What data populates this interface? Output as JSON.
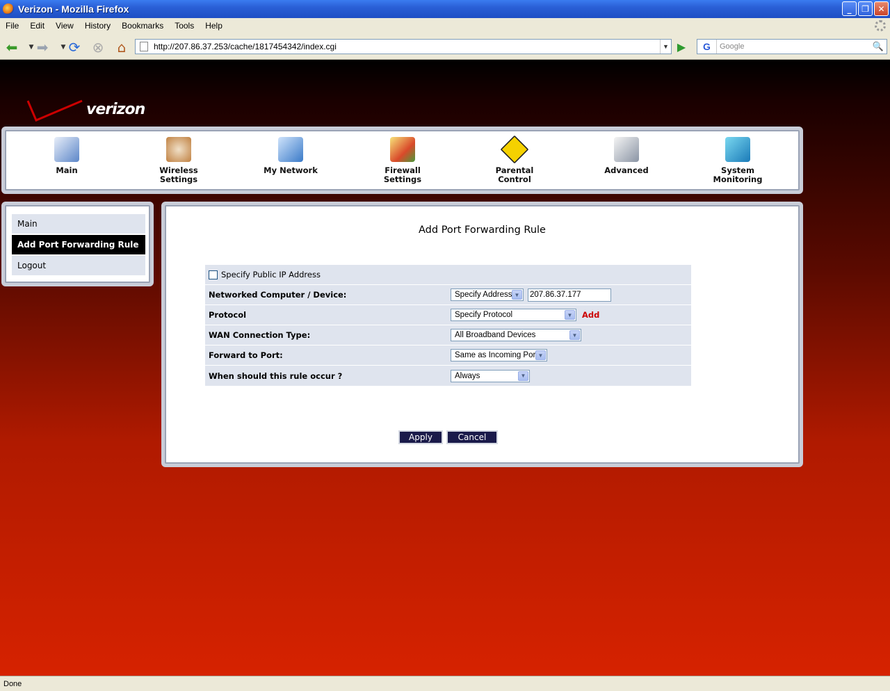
{
  "window": {
    "title": "Verizon - Mozilla Firefox"
  },
  "menu": [
    "File",
    "Edit",
    "View",
    "History",
    "Bookmarks",
    "Tools",
    "Help"
  ],
  "address": {
    "url": "http://207.86.37.253/cache/1817454342/index.cgi"
  },
  "search": {
    "engine": "G",
    "placeholder": "Google"
  },
  "brand": {
    "logo_text": "verizon"
  },
  "topnav": [
    {
      "label": "Main",
      "icon": "main-icon"
    },
    {
      "label": "Wireless\nSettings",
      "icon": "wireless-icon"
    },
    {
      "label": "My Network",
      "icon": "network-icon"
    },
    {
      "label": "Firewall\nSettings",
      "icon": "firewall-icon"
    },
    {
      "label": "Parental\nControl",
      "icon": "parental-lock-icon"
    },
    {
      "label": "Advanced",
      "icon": "advanced-icon"
    },
    {
      "label": "System\nMonitoring",
      "icon": "monitoring-icon"
    }
  ],
  "sidebar": {
    "items": [
      {
        "label": "Main"
      },
      {
        "label": "Add Port Forwarding Rule",
        "active": true
      },
      {
        "label": "Logout"
      }
    ]
  },
  "main": {
    "title": "Add Port Forwarding Rule",
    "specify_public_ip_label": "Specify Public IP Address",
    "fields": {
      "networked_label": "Networked Computer / Device:",
      "networked_select": "Specify Address",
      "networked_ip": "207.86.37.177",
      "protocol_label": "Protocol",
      "protocol_select": "Specify Protocol",
      "protocol_add": "Add",
      "wan_label": "WAN Connection Type:",
      "wan_select": "All Broadband Devices",
      "forward_label": "Forward to Port:",
      "forward_select": "Same as Incoming Port",
      "when_label": "When should this rule occur ?",
      "when_select": "Always"
    },
    "apply_label": "Apply",
    "cancel_label": "Cancel"
  },
  "status": {
    "text": "Done"
  },
  "colors": {
    "brand_red": "#cc0000",
    "nav_active": "#000000",
    "form_bg": "#dfe4ee"
  }
}
